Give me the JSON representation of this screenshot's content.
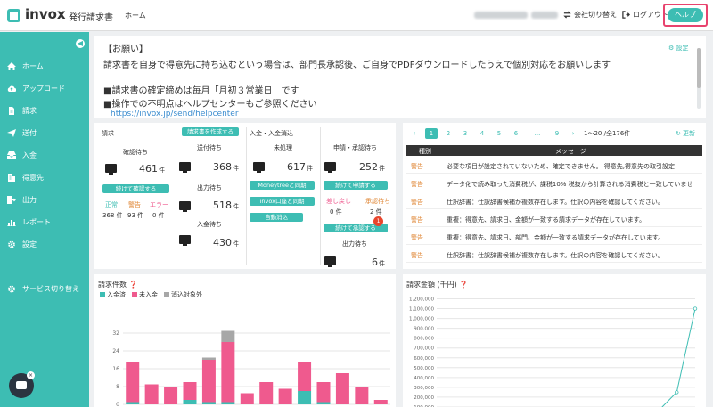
{
  "header": {
    "logo_text": "invox",
    "logo_sub": "発行請求書",
    "nav_home": "ホーム",
    "switch_company": "会社切り替え",
    "logout": "ログアウト",
    "help": "ヘルプ"
  },
  "sidebar": {
    "items": [
      {
        "label": "ホーム",
        "icon": "home-icon"
      },
      {
        "label": "アップロード",
        "icon": "cloud-upload-icon"
      },
      {
        "label": "請求",
        "icon": "document-icon"
      },
      {
        "label": "送付",
        "icon": "send-icon"
      },
      {
        "label": "入金",
        "icon": "inbox-icon"
      },
      {
        "label": "得意先",
        "icon": "building-icon"
      },
      {
        "label": "出力",
        "icon": "export-icon"
      },
      {
        "label": "レポート",
        "icon": "chart-icon"
      },
      {
        "label": "設定",
        "icon": "gear-icon"
      },
      {
        "label": "サービス切り替え",
        "icon": "switch-icon"
      }
    ]
  },
  "notice": {
    "title": "【お願い】",
    "settings": "設定",
    "line1": "請求書を自身で得意先に持ち込むという場合は、部門長承認後、ご自身でPDFダウンロードしたうえで個別対応をお願いします",
    "line2": "■請求書の確定締めは毎月「月初３営業日」です",
    "line3": "■操作での不明点はヘルプセンターもご参照ください",
    "link": "https://invox.jp/send/helpcenter"
  },
  "tasks": {
    "billing_heading": "請求",
    "create_button": "請求書を作成する",
    "confirm_wait": "確認待ち",
    "confirm_count": "461",
    "unit": "件",
    "confirm_button": "続けて確認する",
    "normal_label": "正常",
    "warning_label": "警告",
    "error_label": "エラー",
    "normal_count": "368 件",
    "warning_count": "93 件",
    "error_count": "0 件",
    "send_wait": "送付待ち",
    "send_count": "368",
    "output_wait": "出力待ち",
    "output_count": "518",
    "payment_wait": "入金待ち",
    "payment_count": "430",
    "deposit_heading": "入金・入金消込",
    "unprocessed": "未処理",
    "unprocessed_count": "617",
    "moneytree_button": "Moneytreeと同期",
    "invox_sync_button": "invox口座と同期",
    "auto_clear_button": "自動消込",
    "apply_wait": "申請・承認待ち",
    "apply_count": "252",
    "apply_button": "続けて申請する",
    "returned_label": "差し戻し",
    "returned_count": "0 件",
    "approve_wait_label": "承認待ち",
    "approve_wait_count": "2 件",
    "approve_button": "続けて承認する",
    "approve_badge": "1",
    "output_wait2": "出力待ち",
    "output_count2": "6"
  },
  "messages": {
    "pages": [
      "1",
      "2",
      "3",
      "4",
      "5",
      "6",
      "...",
      "9"
    ],
    "prev": "‹",
    "next": "›",
    "range": "1〜20 /全176件",
    "refresh": "更新",
    "col_kind": "種別",
    "col_message": "メッセージ",
    "rows": [
      {
        "kind": "警告",
        "text": "必要な項目が設定されていないため、確定できません。 得意先,得意先の取引設定"
      },
      {
        "kind": "警告",
        "text": "データ化で読み取った消費税が、課税10% 税抜から計算される消費税と一致していませ"
      },
      {
        "kind": "警告",
        "text": "仕訳辞書：仕訳辞書候補が複数存在します。仕訳の内容を確認してください。"
      },
      {
        "kind": "警告",
        "text": "重複：得意先、請求日、金額が一致する請求データが存在しています。"
      },
      {
        "kind": "警告",
        "text": "重複：得意先、請求日、部門、金額が一致する請求データが存在しています。"
      },
      {
        "kind": "警告",
        "text": "仕訳辞書：仕訳辞書候補が複数存在します。仕訳の内容を確認してください。"
      }
    ]
  },
  "colors": {
    "accent": "#3dbdb3",
    "unpaid": "#ef5a8e",
    "excluded": "#a7a7a7",
    "warning": "#e0893a"
  },
  "chart_data": [
    {
      "type": "bar",
      "title": "請求件数",
      "stacked": true,
      "ylim": [
        0,
        32
      ],
      "yticks": [
        "0",
        "8",
        "16",
        "24",
        "32"
      ],
      "series": [
        {
          "name": "入金済",
          "values": [
            1,
            0,
            0,
            2,
            1,
            1,
            0,
            0,
            0,
            6,
            1,
            0,
            0,
            0
          ]
        },
        {
          "name": "未入金",
          "values": [
            18,
            9,
            8,
            8,
            19,
            27,
            5,
            10,
            7,
            13,
            9,
            14,
            8,
            2
          ]
        },
        {
          "name": "消込対象外",
          "values": [
            0,
            0,
            0,
            0,
            1,
            5,
            0,
            0,
            0,
            0,
            0,
            0,
            0,
            0
          ]
        }
      ]
    },
    {
      "type": "line",
      "title": "請求金額 (千円)",
      "ylim": [
        0,
        1250000
      ],
      "yticks": [
        "0",
        "100,000",
        "200,000",
        "300,000",
        "400,000",
        "500,000",
        "600,000",
        "700,000",
        "800,000",
        "900,000",
        "1,000,000",
        "1,100,000",
        "1,200,000"
      ],
      "series": [
        {
          "name": "",
          "values": [
            5000,
            4000,
            3000,
            8000,
            15000,
            20000,
            6000,
            12000,
            9000,
            25000,
            18000,
            30000,
            60000,
            250000,
            1100000
          ]
        }
      ]
    }
  ]
}
